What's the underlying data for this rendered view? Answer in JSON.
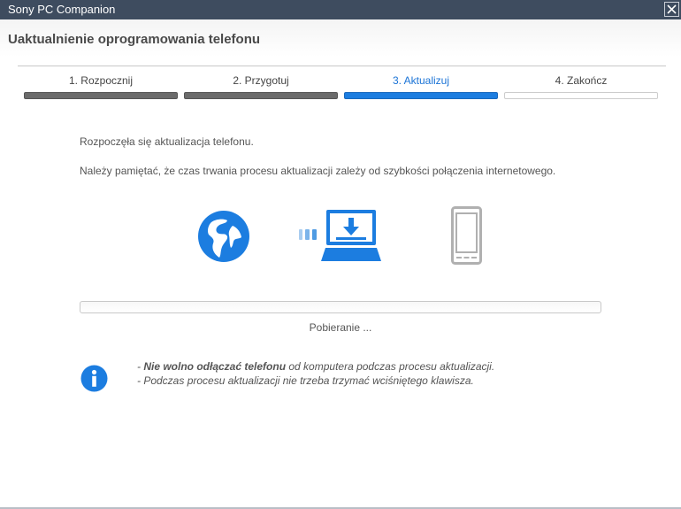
{
  "window": {
    "title": "Sony PC Companion",
    "close_icon": "close-icon"
  },
  "header": {
    "title": "Uaktualnienie oprogramowania telefonu"
  },
  "steps": [
    {
      "label": "1. Rozpocznij",
      "state": "done"
    },
    {
      "label": "2. Przygotuj",
      "state": "done"
    },
    {
      "label": "3. Aktualizuj",
      "state": "active"
    },
    {
      "label": "4. Zakończ",
      "state": "todo"
    }
  ],
  "content": {
    "started": "Rozpoczęła się aktualizacja telefonu.",
    "note": "Należy pamiętać, że czas trwania procesu aktualizacji zależy od szybkości połączenia internetowego."
  },
  "illustration": {
    "icons": [
      "globe-icon",
      "transfer-dots-icon",
      "laptop-download-icon",
      "phone-icon"
    ]
  },
  "progress": {
    "fraction": 0.0,
    "status": "Pobieranie ..."
  },
  "warnings": {
    "icon": "info-icon",
    "line1_prefix": "- ",
    "line1_bold": "Nie wolno odłączać telefonu",
    "line1_rest": " od komputera podczas procesu aktualizacji.",
    "line2": "- Podczas procesu aktualizacji nie trzeba trzymać wciśniętego klawisza."
  },
  "colors": {
    "accent": "#1c7de0",
    "titlebar": "#3e4c5f",
    "step_done": "#6b6b6b",
    "phone_gray": "#b0b0b0"
  }
}
